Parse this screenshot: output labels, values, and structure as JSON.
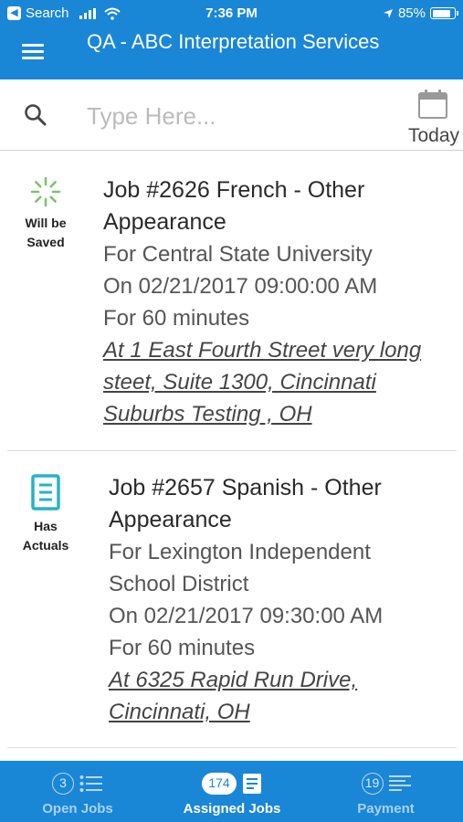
{
  "status_bar": {
    "back_label": "Search",
    "time": "7:36 PM",
    "battery": "85%",
    "battery_level": 0.85
  },
  "header": {
    "title": "QA - ABC Interpretation Services"
  },
  "search": {
    "placeholder": "Type Here...",
    "value": "",
    "today_label": "Today"
  },
  "jobs": [
    {
      "status_icon": "spinner-icon",
      "status_line1": "Will be",
      "status_line2": "Saved",
      "title_line1": "Job #2626 French - Other",
      "title_line2": "Appearance",
      "client": "For Central State University",
      "datetime": "On 02/21/2017 09:00:00 AM",
      "duration": "For 60 minutes",
      "address_line1": "At 1 East Fourth Street very long",
      "address_line2": "steet, Suite 1300, Cincinnati",
      "address_line3": "Suburbs Testing , OH"
    },
    {
      "status_icon": "document-icon",
      "status_line1": "Has",
      "status_line2": "Actuals",
      "title_line1": "Job #2657 Spanish - Other",
      "title_line2": "Appearance",
      "client_line1": "For Lexington Independent",
      "client_line2": "School District",
      "datetime": "On 02/21/2017 09:30:00 AM",
      "duration": "For 60 minutes",
      "address_line1": "At 6325 Rapid Run Drive,",
      "address_line2": "Cincinnati, OH"
    }
  ],
  "tabs": [
    {
      "count": "3",
      "label": "Open Jobs",
      "icon": "list-icon",
      "active": false
    },
    {
      "count": "174",
      "label": "Assigned Jobs",
      "icon": "document-icon",
      "active": true
    },
    {
      "count": "19",
      "label": "Payment",
      "icon": "lines-icon",
      "active": false
    }
  ],
  "colors": {
    "brand_blue": "#1a86d6",
    "spinner_green": "#7cc36e",
    "doc_teal": "#26b3c9"
  }
}
